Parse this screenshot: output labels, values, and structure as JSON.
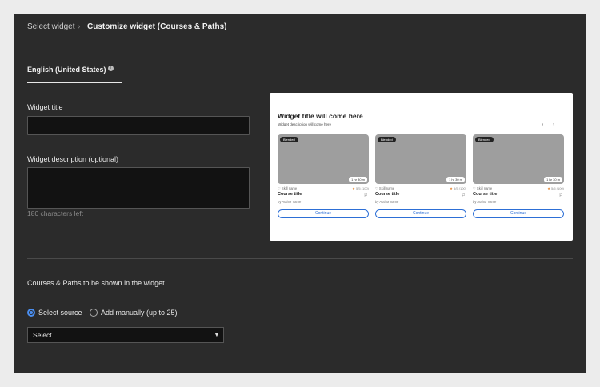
{
  "breadcrumb": {
    "step1": "Select widget",
    "separator": "›",
    "step2": "Customize widget (Courses & Paths)"
  },
  "locale": {
    "label": "English (United States)",
    "info_icon": "i"
  },
  "form": {
    "widget_title_label": "Widget title",
    "widget_title_value": "",
    "widget_description_label": "Widget description (optional)",
    "widget_description_value": "",
    "chars_left": "180 characters left",
    "courses_label": "Courses & Paths to be shown in the widget",
    "source_options": [
      {
        "label": "Select source",
        "selected": true
      },
      {
        "label": "Add manually (up to 25)",
        "selected": false
      }
    ],
    "select_value": "Select",
    "select_icon": "chevron-down-icon"
  },
  "preview": {
    "title": "Widget title will come here",
    "description": "Widget description will come here",
    "prev_arrow": "‹",
    "next_arrow": "›",
    "cards": [
      {
        "badge": "Blended",
        "duration": "1 hr 30 m",
        "skill": "Skill name",
        "rating": "5/5 (100)",
        "title": "Course title",
        "author": "by Author name",
        "button": "Continue"
      },
      {
        "badge": "Blended",
        "duration": "1 hr 30 m",
        "skill": "Skill name",
        "rating": "5/5 (100)",
        "title": "Course title",
        "author": "by Author name",
        "button": "Continue"
      },
      {
        "badge": "Blended",
        "duration": "1 hr 30 m",
        "skill": "Skill name",
        "rating": "5/5 (100)",
        "title": "Course title",
        "author": "by Author name",
        "button": "Continue"
      }
    ]
  },
  "colors": {
    "panel_bg": "#2b2b2b",
    "accent": "#4a8ef0",
    "button_blue": "#2d6fd6",
    "star": "#e07a1f"
  }
}
